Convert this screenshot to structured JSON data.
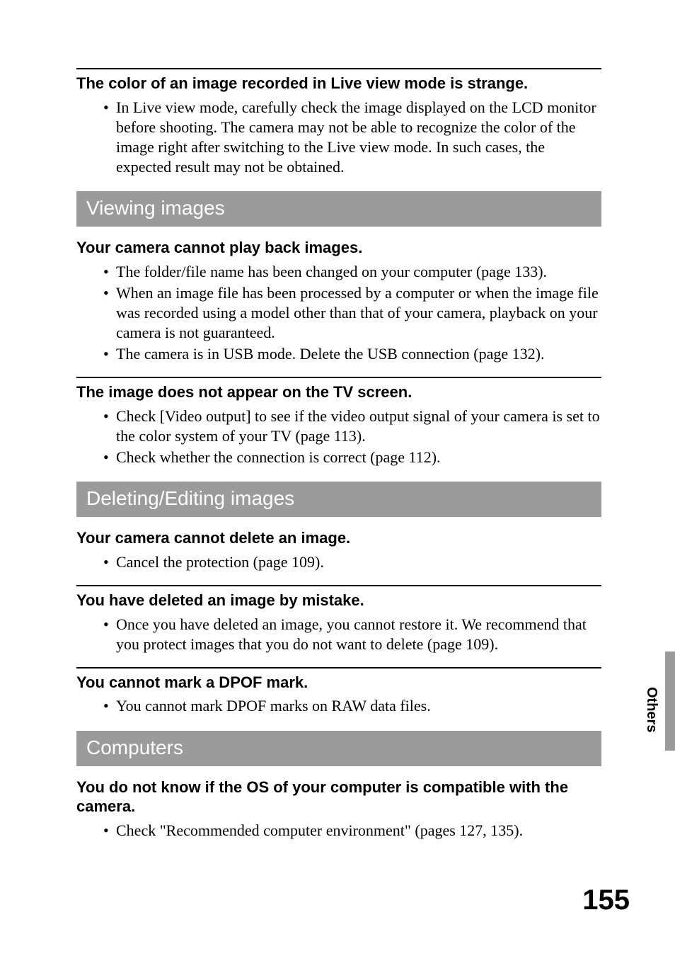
{
  "sideLabel": "Others",
  "pageNumber": "155",
  "blocks": [
    {
      "rule": true,
      "title": "The color of an image recorded in Live view mode is strange.",
      "bullets": [
        "In Live view mode, carefully check the image displayed on the LCD monitor before shooting. The camera may not be able to recognize the color of the image right after switching to the Live view mode. In such cases, the expected result may not be obtained."
      ]
    },
    {
      "section": "Viewing images"
    },
    {
      "title": "Your camera cannot play back images.",
      "bullets": [
        "The folder/file name has been changed on your computer (page 133).",
        "When an image file has been processed by a computer or when the image file was recorded using a model other than that of your camera, playback on your camera is not guaranteed.",
        "The camera is in USB mode. Delete the USB connection (page 132)."
      ]
    },
    {
      "rule": true,
      "title": "The image does not appear on the TV screen.",
      "bullets": [
        "Check [Video output] to see if the video output signal of your camera is set to the color system of your TV (page 113).",
        "Check whether the connection is correct (page 112)."
      ]
    },
    {
      "section": "Deleting/Editing images"
    },
    {
      "title": "Your camera cannot delete an image.",
      "bullets": [
        "Cancel the protection (page 109)."
      ]
    },
    {
      "rule": true,
      "title": "You have deleted an image by mistake.",
      "bullets": [
        "Once you have deleted an image, you cannot restore it. We recommend that you protect images that you do not want to delete (page 109)."
      ]
    },
    {
      "rule": true,
      "title": "You cannot mark a DPOF mark.",
      "bullets": [
        "You cannot mark DPOF marks on RAW data files."
      ]
    },
    {
      "section": "Computers"
    },
    {
      "title": "You do not know if the OS of your computer is compatible with the camera.",
      "bullets": [
        "Check \"Recommended computer environment\" (pages 127, 135)."
      ]
    }
  ]
}
